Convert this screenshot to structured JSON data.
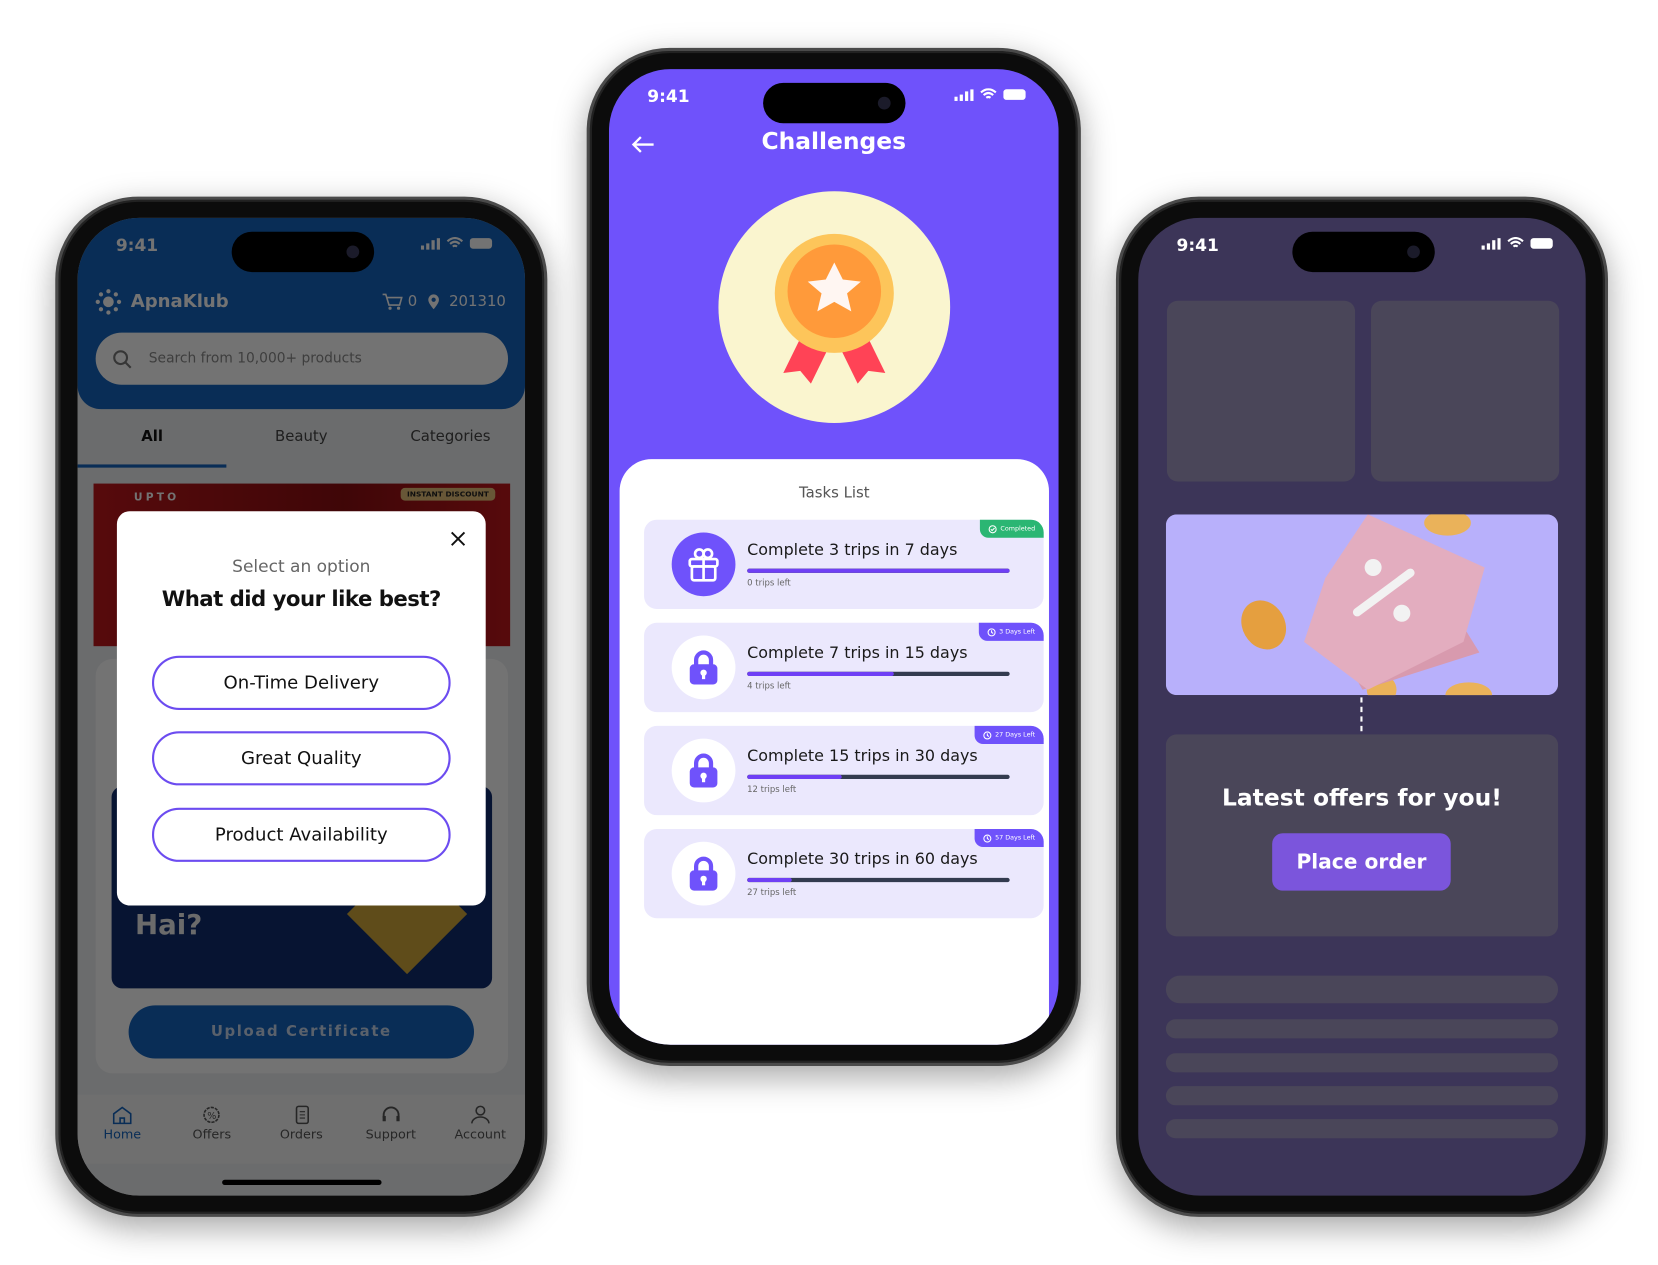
{
  "status_time": "9:41",
  "left_app": {
    "brand": "ApnaKlub",
    "cart_count": "0",
    "pincode": "201310",
    "search_placeholder": "Search from 10,000+ products",
    "tabs": [
      {
        "label": "All",
        "active": true
      },
      {
        "label": "Beauty",
        "active": false
      },
      {
        "label": "Categories",
        "active": false
      }
    ],
    "banner_text": "UPTO",
    "banner_badge": "INSTANT DISCOUNT",
    "promo_text": "Hai?",
    "upload_button": "Upload Certificate",
    "nav": [
      {
        "label": "Home",
        "icon": "home-icon",
        "active": true
      },
      {
        "label": "Offers",
        "icon": "offers-icon",
        "active": false
      },
      {
        "label": "Orders",
        "icon": "orders-icon",
        "active": false
      },
      {
        "label": "Support",
        "icon": "headset-icon",
        "active": false
      },
      {
        "label": "Account",
        "icon": "account-icon",
        "active": false
      }
    ],
    "modal": {
      "subtitle": "Select an option",
      "title": "What did your like best?",
      "options": [
        "On-Time Delivery",
        "Great Quality",
        "Product Availability"
      ]
    },
    "colors": {
      "brand": "#1565c0",
      "option_border": "#6c4cf0"
    }
  },
  "challenges_app": {
    "title": "Challenges",
    "list_title": "Tasks List",
    "tasks": [
      {
        "title": "Complete 3 trips in 7 days",
        "sub": "0 trips left",
        "badge": "Completed",
        "status": "completed",
        "icon": "gift-icon",
        "progress": 1.0
      },
      {
        "title": "Complete 7 trips in 15 days",
        "sub": "4 trips left",
        "badge": "3 Days Left",
        "status": "locked",
        "icon": "lock-icon",
        "progress": 0.56
      },
      {
        "title": "Complete 15 trips in 30 days",
        "sub": "12 trips left",
        "badge": "27 Days Left",
        "status": "locked",
        "icon": "lock-icon",
        "progress": 0.36
      },
      {
        "title": "Complete 30 trips in 60 days",
        "sub": "27 trips left",
        "badge": "57 Days Left",
        "status": "locked",
        "icon": "lock-icon",
        "progress": 0.17
      }
    ],
    "colors": {
      "primary": "#6f52fb",
      "completed": "#2bb673",
      "card": "#ebe8fd"
    }
  },
  "offers_app": {
    "headline": "Latest offers for you!",
    "button": "Place order",
    "colors": {
      "background": "#3c3558",
      "placeholder": "#4a4659",
      "button": "#7b55dc",
      "banner": "#b8b0fb"
    }
  }
}
